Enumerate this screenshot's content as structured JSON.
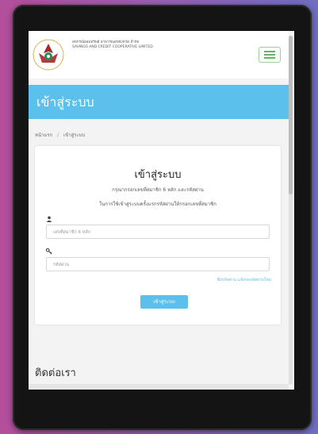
{
  "header": {
    "org_name_line1": "สหกรณ์ออมทรัพย์ สาธารณสุขจังหวัด จำกัด",
    "org_name_line2": "SAVINGS AND CREDIT COOPERATIVE LIMITED"
  },
  "banner": {
    "title": "เข้าสู่ระบบ"
  },
  "breadcrumb": {
    "home": "หน้าแรก",
    "separator": "/",
    "current": "เข้าสู่ระบบ"
  },
  "login_card": {
    "title": "เข้าสู่ระบบ",
    "subtitle_line1": "กรุณากรอกเลขที่สมาชิก 6 หลัก และรหัสผ่าน",
    "subtitle_line2": "ในการใช้เข้าสู่ระบบครั้งแรกรหัสผ่านให้กรอกเลขที่สมาชิก",
    "member_placeholder": "เลขที่สมาชิก 6 หลัก",
    "password_placeholder": "รหัสผ่าน",
    "forgot_link": "ลืมรหัสผ่าน แจ้งขอรหัสผ่านใหม่",
    "login_button": "เข้าสู่ระบบ"
  },
  "contact": {
    "title": "ติดต่อเรา"
  },
  "colors": {
    "accent": "#5bc0eb",
    "menu_border": "#9ccf9a",
    "device_frame": "#141414",
    "background_left": "#b44f9c",
    "background_right": "#6f6ec3"
  },
  "icons": {
    "logo": "cooperative-emblem-icon",
    "menu": "hamburger-menu-icon",
    "user": "user-icon",
    "key": "key-icon"
  }
}
